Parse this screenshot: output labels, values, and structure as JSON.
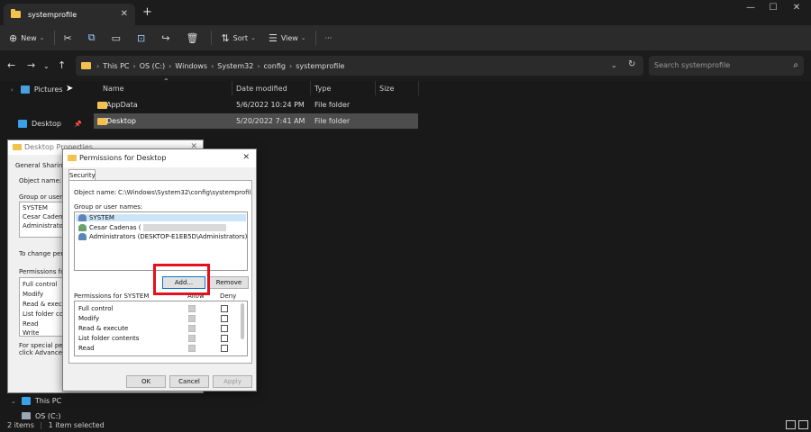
{
  "window": {
    "tab_title": "systemprofile",
    "new_tab": "+",
    "close": "✕",
    "minimize": "—",
    "maximize": "☐"
  },
  "toolbar": {
    "new_label": "New",
    "sort_label": "Sort",
    "view_label": "View",
    "more": "···"
  },
  "address": {
    "crumbs": [
      "This PC",
      "OS (C:)",
      "Windows",
      "System32",
      "config",
      "systemprofile"
    ],
    "search_placeholder": "Search systemprofile"
  },
  "sidebar": {
    "items": [
      "Pictures",
      "Desktop",
      "This PC",
      "OS (C:)"
    ]
  },
  "filelist": {
    "columns": [
      "Name",
      "Date modified",
      "Type",
      "Size"
    ],
    "rows": [
      {
        "name": "AppData",
        "date": "5/6/2022 10:24 PM",
        "type": "File folder",
        "size": ""
      },
      {
        "name": "Desktop",
        "date": "5/20/2022 7:41 AM",
        "type": "File folder",
        "size": ""
      }
    ]
  },
  "status": {
    "items": "2 items",
    "selected": "1 item selected"
  },
  "back_dialog": {
    "title": "Desktop Properties",
    "tab_general": "General",
    "tab_sharing": "Sharing",
    "object_name": "Object name:",
    "group_label": "Group or user nar",
    "users": [
      "SYSTEM",
      "Cesar Cadena",
      "Administrato"
    ],
    "to_change": "To change perm",
    "permissions_label": "Permissions for S",
    "perms": [
      "Full control",
      "Modify",
      "Read & execut",
      "List folder cont",
      "Read",
      "Write"
    ],
    "special1": "For special permis",
    "special2": "click Advanced."
  },
  "dialog": {
    "title": "Permissions for Desktop",
    "tab_security": "Security",
    "object_name_label": "Object name:",
    "object_name_value": "C:\\Windows\\System32\\config\\systemprofile\\Deskt",
    "group_label": "Group or user names:",
    "users": [
      {
        "name": "SYSTEM"
      },
      {
        "name": "Cesar Cadenas ("
      },
      {
        "name": "Administrators (DESKTOP-E1EB5D\\Administrators)"
      }
    ],
    "add_button": "Add...",
    "remove_button": "Remove",
    "perm_header": "Permissions for SYSTEM",
    "allow_header": "Allow",
    "deny_header": "Deny",
    "perms": [
      "Full control",
      "Modify",
      "Read & execute",
      "List folder contents",
      "Read"
    ],
    "ok": "OK",
    "cancel": "Cancel",
    "apply": "Apply"
  }
}
